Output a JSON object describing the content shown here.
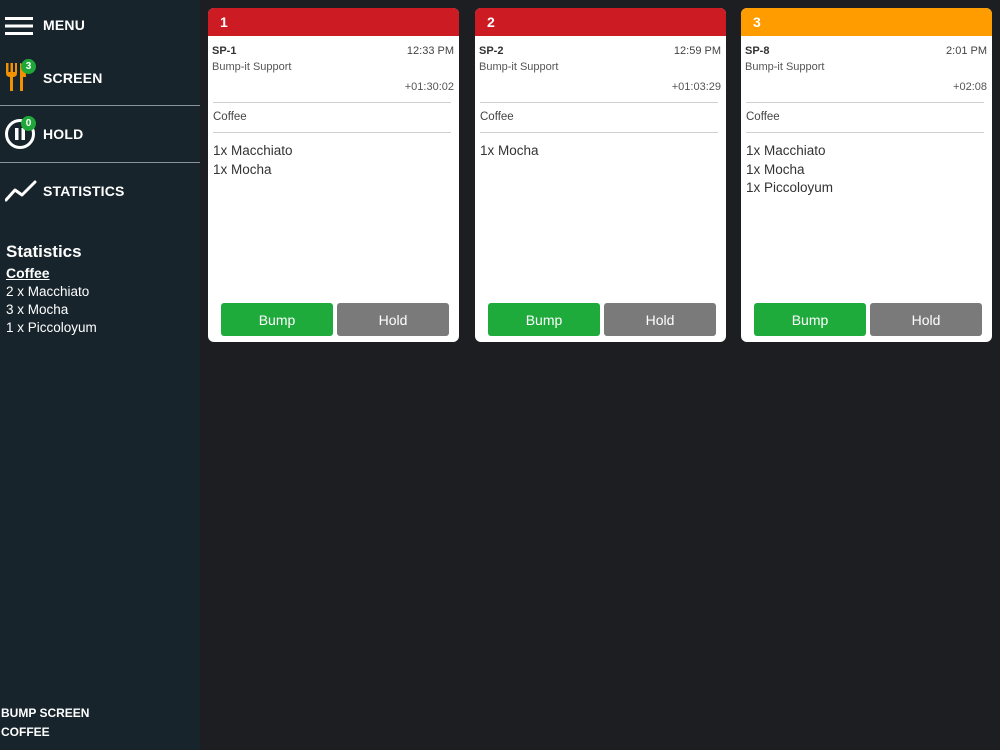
{
  "sidebar": {
    "menu_label": "MENU",
    "screen_label": "SCREEN",
    "screen_badge": "3",
    "hold_label": "HOLD",
    "hold_badge": "0",
    "statistics_label": "STATISTICS"
  },
  "statistics": {
    "title": "Statistics",
    "category": "Coffee",
    "lines": [
      "2 x Macchiato",
      "3 x Mocha",
      "1 x Piccoloyum"
    ]
  },
  "footer": {
    "line1": "BUMP SCREEN",
    "line2": "COFFEE"
  },
  "colors": {
    "urgent": "#cc1b23",
    "warning": "#ff9c00",
    "bump": "#1faa3c",
    "hold": "#7a7a7a"
  },
  "tickets": [
    {
      "number": "1",
      "status_color": "#cc1b23",
      "id": "SP-1",
      "time": "12:33 PM",
      "source": "Bump-it Support",
      "elapsed": "+01:30:02",
      "category": "Coffee",
      "items": [
        "1x Macchiato",
        "1x Mocha"
      ],
      "bump_label": "Bump",
      "hold_label": "Hold"
    },
    {
      "number": "2",
      "status_color": "#cc1b23",
      "id": "SP-2",
      "time": "12:59 PM",
      "source": "Bump-it Support",
      "elapsed": "+01:03:29",
      "category": "Coffee",
      "items": [
        "1x Mocha"
      ],
      "bump_label": "Bump",
      "hold_label": "Hold"
    },
    {
      "number": "3",
      "status_color": "#ff9c00",
      "id": "SP-8",
      "time": "2:01 PM",
      "source": "Bump-it Support",
      "elapsed": "+02:08",
      "category": "Coffee",
      "items": [
        "1x Macchiato",
        "1x Mocha",
        "1x Piccoloyum"
      ],
      "bump_label": "Bump",
      "hold_label": "Hold"
    }
  ]
}
